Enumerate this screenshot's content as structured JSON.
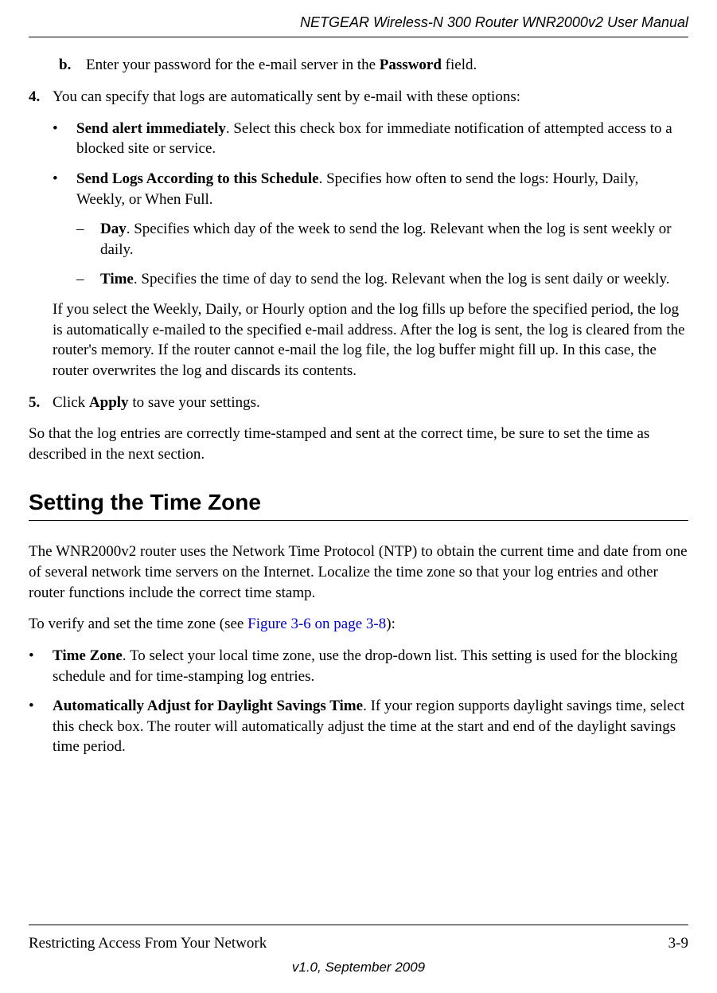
{
  "header": {
    "title": "NETGEAR Wireless-N 300 Router WNR2000v2 User Manual"
  },
  "body": {
    "step_b_marker": "b.",
    "step_b_pre": "Enter your password for the e-mail server in the ",
    "step_b_bold": "Password",
    "step_b_post": " field.",
    "step_4_marker": "4.",
    "step_4_text": "You can specify that logs are automatically sent by e-mail with these options:",
    "bullet1_bold": "Send alert immediately",
    "bullet1_rest": ". Select this check box for immediate notification of attempted access to a blocked site or service.",
    "bullet2_bold": "Send Logs According to this Schedule",
    "bullet2_rest": ". Specifies how often to send the logs: Hourly, Daily, Weekly, or When Full.",
    "dash1_bold": "Day",
    "dash1_rest": ". Specifies which day of the week to send the log. Relevant when the log is sent weekly or daily.",
    "dash2_bold": "Time",
    "dash2_rest": ". Specifies the time of day to send the log. Relevant when the log is sent daily or weekly.",
    "step4_para": "If you select the Weekly, Daily, or Hourly option and the log fills up before the specified period, the log is automatically e-mailed to the specified e-mail address. After the log is sent, the log is cleared from the router's memory. If the router cannot e-mail the log file, the log buffer might fill up. In this case, the router overwrites the log and discards its contents.",
    "step_5_marker": "5.",
    "step_5_pre": "Click ",
    "step_5_bold": "Apply",
    "step_5_post": " to save your settings.",
    "closing_para": "So that the log entries are correctly time-stamped and sent at the correct time, be sure to set the time as described in the next section.",
    "section_title": "Setting the Time Zone",
    "tz_para1": "The WNR2000v2 router uses the Network Time Protocol (NTP) to obtain the current time and date from one of several network time servers on the Internet. Localize the time zone so that your log entries and other router functions include the correct time stamp.",
    "tz_para2_pre": "To verify and set the time zone (see ",
    "tz_para2_link": "Figure 3-6 on page 3-8",
    "tz_para2_post": "):",
    "tz_b1_bold": "Time Zone",
    "tz_b1_rest": ". To select your local time zone, use the drop-down list. This setting is used for the blocking schedule and for time-stamping log entries.",
    "tz_b2_bold": "Automatically Adjust for Daylight Savings Time",
    "tz_b2_rest": ". If your region supports daylight savings time, select this check box. The router will automatically adjust the time at the start and end of the daylight savings time period."
  },
  "footer": {
    "section": "Restricting Access From Your Network",
    "page_num": "3-9",
    "version": "v1.0, September 2009"
  },
  "glyphs": {
    "bullet": "•",
    "dash": "–"
  }
}
